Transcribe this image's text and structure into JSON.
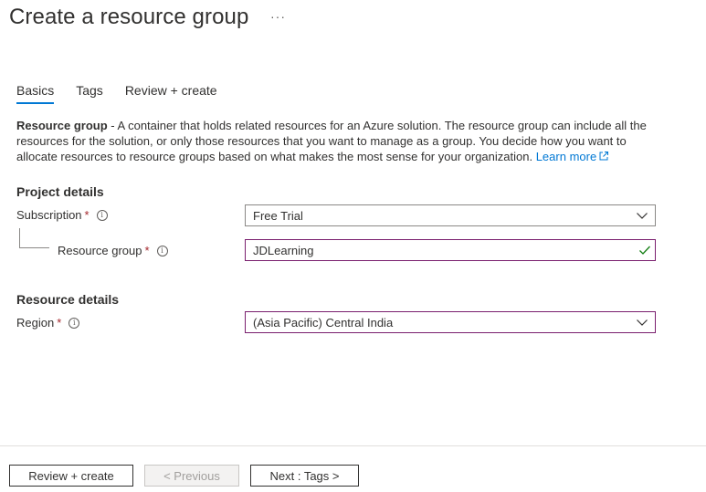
{
  "header": {
    "title": "Create a resource group",
    "more_label": "···"
  },
  "tabs": [
    {
      "label": "Basics",
      "active": true
    },
    {
      "label": "Tags",
      "active": false
    },
    {
      "label": "Review + create",
      "active": false
    }
  ],
  "description": {
    "bold": "Resource group",
    "text": " - A container that holds related resources for an Azure solution. The resource group can include all the resources for the solution, or only those resources that you want to manage as a group. You decide how you want to allocate resources to resource groups based on what makes the most sense for your organization. ",
    "link": "Learn more"
  },
  "project_details": {
    "title": "Project details",
    "subscription": {
      "label": "Subscription",
      "required": "*",
      "value": "Free Trial"
    },
    "resource_group": {
      "label": "Resource group",
      "required": "*",
      "value": "JDLearning"
    }
  },
  "resource_details": {
    "title": "Resource details",
    "region": {
      "label": "Region",
      "required": "*",
      "value": "(Asia Pacific) Central India"
    }
  },
  "footer": {
    "review_create": "Review + create",
    "previous": "< Previous",
    "next": "Next : Tags >"
  },
  "colors": {
    "accent": "#0078d4",
    "focus_border": "#7a1f6e",
    "required": "#a4262c",
    "valid": "#107c10"
  },
  "icons": {
    "info": "info-icon",
    "chevron": "chevron-down-icon",
    "check": "checkmark-icon",
    "external": "external-link-icon"
  }
}
